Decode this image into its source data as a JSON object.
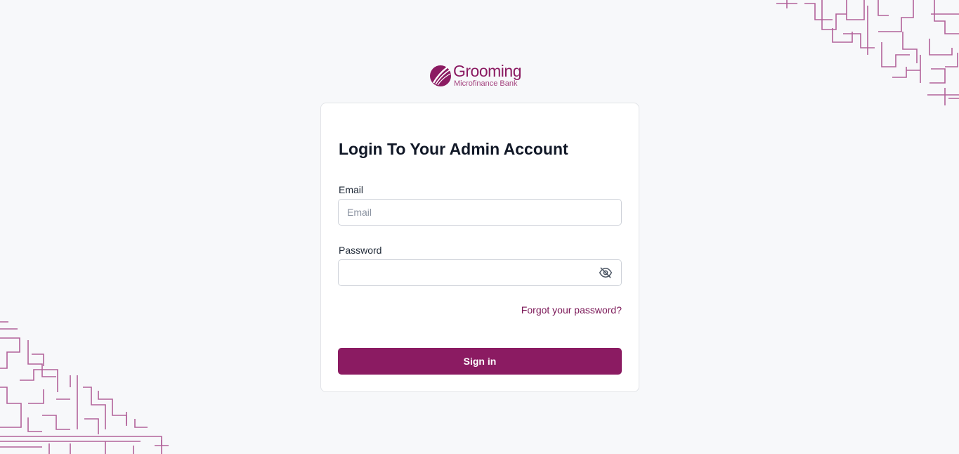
{
  "brand": {
    "name": "Grooming",
    "subtitle": "Microfinance Bank",
    "color": "#8b1b62"
  },
  "login": {
    "title": "Login To Your Admin Account",
    "email_label": "Email",
    "email_placeholder": "Email",
    "email_value": "",
    "password_label": "Password",
    "password_value": "",
    "password_toggle_icon": "eye-off-icon",
    "forgot_link": "Forgot your password?",
    "signin_label": "Sign in"
  },
  "colors": {
    "background": "#f7f8fa",
    "accent": "#8b1b62",
    "pattern": "#b2629a"
  }
}
